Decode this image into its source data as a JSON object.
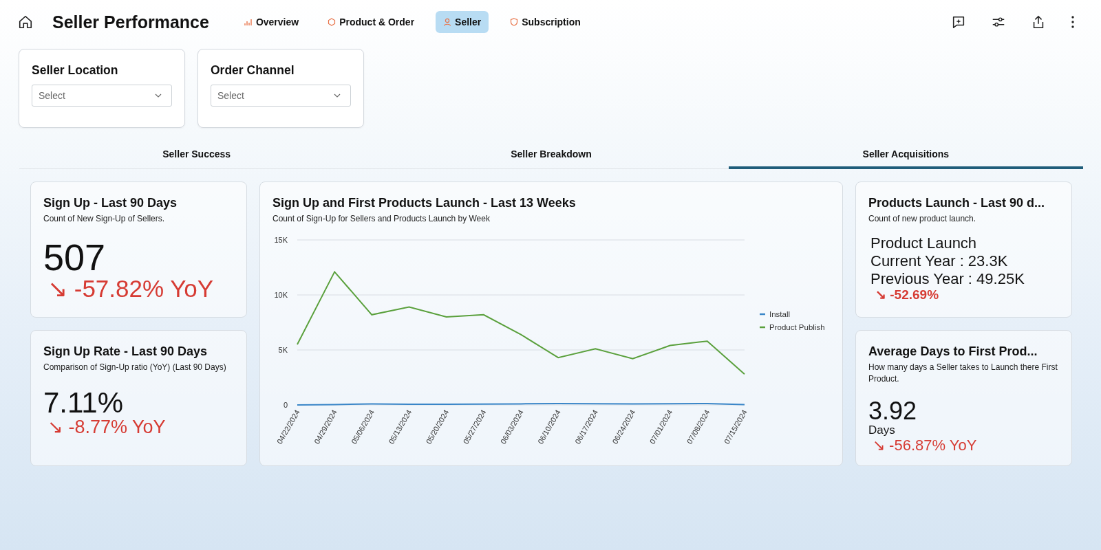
{
  "header": {
    "title": "Seller Performance"
  },
  "nav_tabs": [
    {
      "label": "Overview",
      "selected": false
    },
    {
      "label": "Product & Order",
      "selected": false
    },
    {
      "label": "Seller",
      "selected": true
    },
    {
      "label": "Subscription",
      "selected": false
    }
  ],
  "filters": [
    {
      "label": "Seller Location",
      "placeholder": "Select"
    },
    {
      "label": "Order Channel",
      "placeholder": "Select"
    }
  ],
  "section_tabs": [
    {
      "label": "Seller Success",
      "selected": false
    },
    {
      "label": "Seller Breakdown",
      "selected": false
    },
    {
      "label": "Seller Acquisitions",
      "selected": true
    }
  ],
  "cards": {
    "sign_up": {
      "title": "Sign Up - Last 90 Days",
      "subtitle": "Count of New Sign-Up of Sellers.",
      "value": "507",
      "change": "↘ -57.82% YoY"
    },
    "sign_up_rate": {
      "title": "Sign Up Rate - Last 90 Days",
      "subtitle": "Comparison of Sign-Up ratio (YoY) (Last 90 Days)",
      "value": "7.11%",
      "change": "↘ -8.77% YoY"
    },
    "products_launch": {
      "title": "Products Launch - Last 90 d...",
      "subtitle": "Count of new product launch.",
      "lines": [
        "Product Launch",
        "Current Year : 23.3K",
        "Previous Year : 49.25K"
      ],
      "change": "↘ -52.69%"
    },
    "avg_days": {
      "title": "Average Days to First Prod...",
      "subtitle": "How many days a Seller takes to Launch there First Product.",
      "value": "3.92",
      "unit": "Days",
      "change": "↘ -56.87% YoY"
    }
  },
  "chart_card": {
    "title": "Sign Up and First Products Launch - Last 13 Weeks",
    "subtitle": "Count of Sign-Up for Sellers and Products Launch by Week",
    "chart_data": {
      "type": "line",
      "categories": [
        "04/22/2024",
        "04/29/2024",
        "05/06/2024",
        "05/13/2024",
        "05/20/2024",
        "05/27/2024",
        "06/03/2024",
        "06/10/2024",
        "06/17/2024",
        "06/24/2024",
        "07/01/2024",
        "07/08/2024",
        "07/15/2024"
      ],
      "series": [
        {
          "name": "Install",
          "color": "#3a86c8",
          "values": [
            0,
            40,
            90,
            70,
            60,
            80,
            100,
            120,
            110,
            100,
            110,
            120,
            30
          ]
        },
        {
          "name": "Product Publish",
          "color": "#5aa03c",
          "values": [
            5500,
            12100,
            8200,
            8900,
            8000,
            8200,
            6400,
            4300,
            5100,
            4200,
            5400,
            5800,
            2800
          ]
        }
      ],
      "legend": true,
      "ylim": [
        0,
        15000
      ],
      "yticks": [
        {
          "value": 0,
          "label": "0"
        },
        {
          "value": 5000,
          "label": "5K"
        },
        {
          "value": 10000,
          "label": "10K"
        },
        {
          "value": 15000,
          "label": "15K"
        }
      ]
    }
  }
}
